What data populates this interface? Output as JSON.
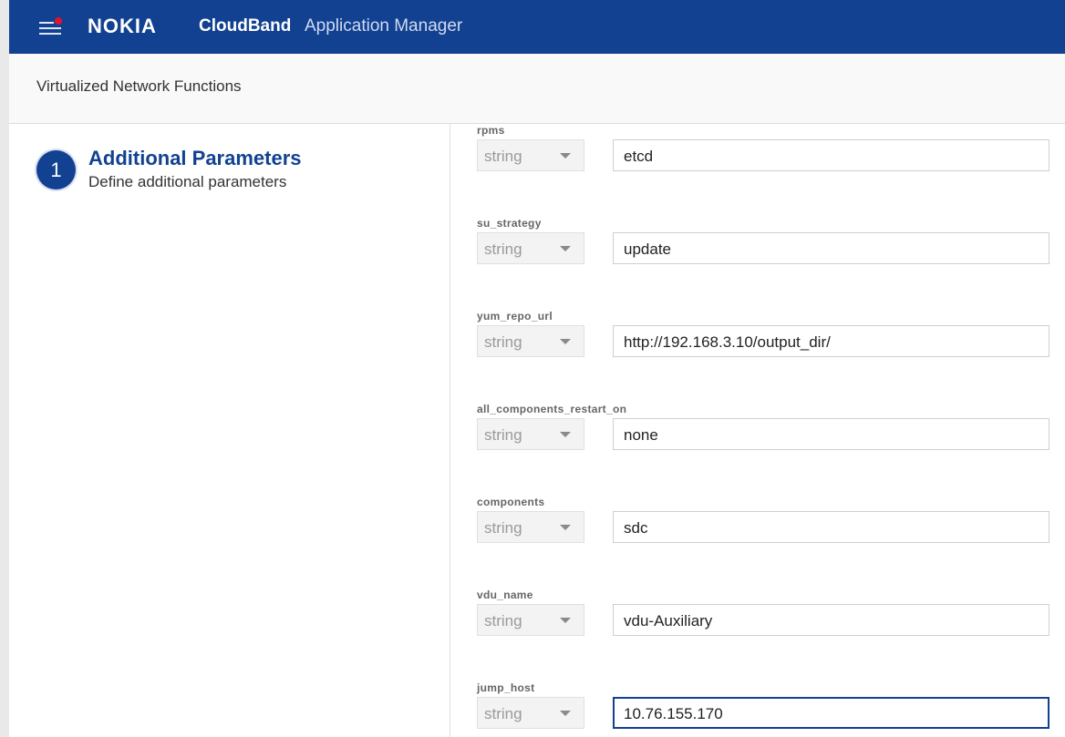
{
  "topbar": {
    "brand": "NOKIA",
    "product": "CloudBand",
    "app_name": "Application Manager"
  },
  "header": {
    "title": "Virtualized Network Functions"
  },
  "step": {
    "number": "1",
    "title": "Additional Parameters",
    "subtitle": "Define additional parameters"
  },
  "parameters": [
    {
      "name": "rpms",
      "type": "string",
      "value": "etcd"
    },
    {
      "name": "su_strategy",
      "type": "string",
      "value": "update"
    },
    {
      "name": "yum_repo_url",
      "type": "string",
      "value": "http://192.168.3.10/output_dir/"
    },
    {
      "name": "all_components_restart_on",
      "type": "string",
      "value": "none"
    },
    {
      "name": "components",
      "type": "string",
      "value": "sdc"
    },
    {
      "name": "vdu_name",
      "type": "string",
      "value": "vdu-Auxiliary"
    },
    {
      "name": "jump_host",
      "type": "string",
      "value": "10.76.155.170"
    }
  ],
  "colors": {
    "brand_blue": "#124191",
    "notification_red": "#e8112d"
  }
}
